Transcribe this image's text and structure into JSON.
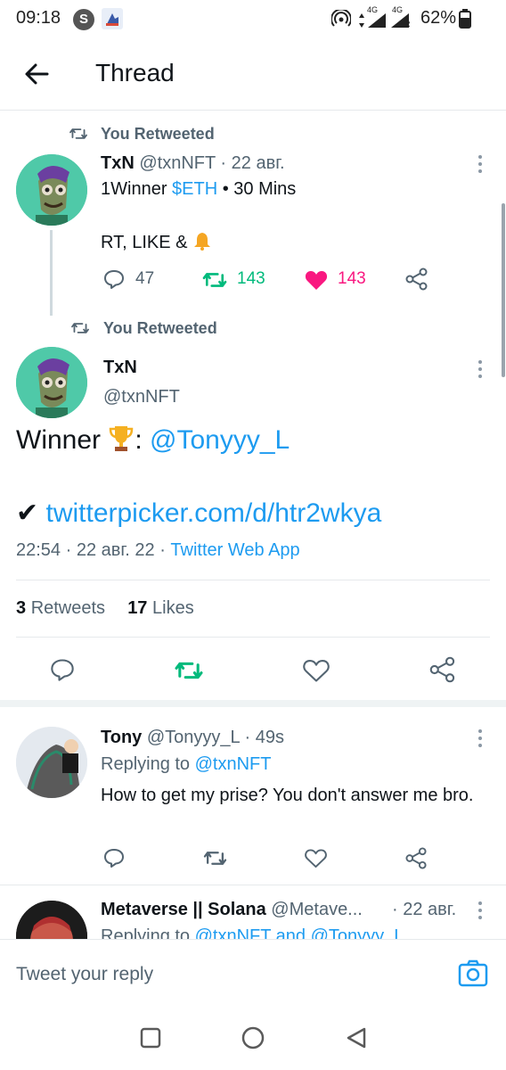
{
  "status_bar": {
    "time": "09:18",
    "s_badge": "S",
    "network_4g_a": "4G",
    "network_4g_b": "4G",
    "network_r": "R",
    "battery": "62%"
  },
  "header": {
    "title": "Thread"
  },
  "tweet1": {
    "retweet_label": "You Retweeted",
    "name": "TxN",
    "handle": "@txnNFT",
    "sep": "·",
    "time": "22 авг.",
    "line1_a": "1Winner ",
    "line1_link": "$ETH",
    "line1_b": " • 30 Mins",
    "line2": "RT, LIKE &",
    "replies": "47",
    "retweets": "143",
    "likes": "143"
  },
  "tweet2": {
    "retweet_label": "You Retweeted",
    "name": "TxN",
    "handle": "@txnNFT",
    "text_a": "Winner ",
    "text_colon": ": ",
    "text_mention": "@Tonyyy_L",
    "check": "✔",
    "link": "twitterpicker.com/d/htr2wkya",
    "time": "22:54",
    "sep1": "·",
    "date": "22 авг. 22",
    "sep2": "·",
    "source": "Twitter Web App",
    "retweet_count": "3",
    "retweet_word": "Retweets",
    "like_count": "17",
    "like_word": "Likes"
  },
  "reply1": {
    "name": "Tony",
    "handle": "@Tonyyy_L",
    "sep": "·",
    "time": "49s",
    "replying_to": "Replying to ",
    "replying_handle": "@txnNFT",
    "text": "How to get my prise? You don't answer me bro."
  },
  "reply2": {
    "name": "Metaverse || Solana",
    "handle": "@Metave...",
    "sep": "·",
    "time": "22 авг.",
    "replying_to": "Replying to ",
    "replying_handles": "@txnNFT and @Tonyyy_L"
  },
  "composer": {
    "placeholder": "Tweet your reply"
  },
  "colors": {
    "accent": "#1d9bf0",
    "retweet": "#00ba7c",
    "like": "#f91880",
    "secondary": "#536471"
  }
}
